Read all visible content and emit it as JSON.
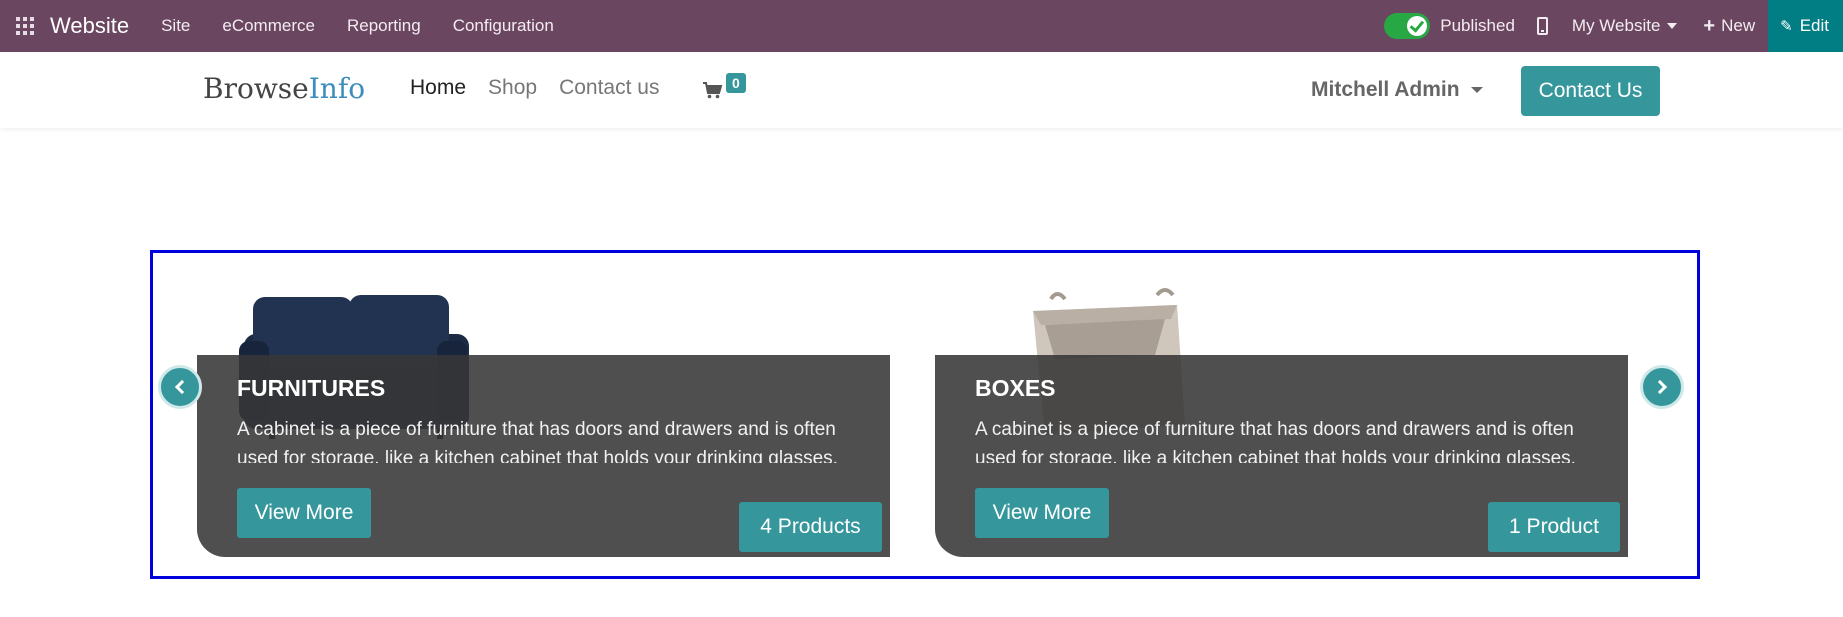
{
  "topbar": {
    "app_name": "Website",
    "menu": [
      "Site",
      "eCommerce",
      "Reporting",
      "Configuration"
    ],
    "published_label": "Published",
    "website_selector": "My Website",
    "new_label": "New",
    "edit_label": "Edit",
    "colors": {
      "background": "#6b4660",
      "edit_background": "#017e84",
      "toggle_on": "#28a745"
    }
  },
  "header": {
    "logo_part1": "Browse",
    "logo_part2": "Info",
    "nav": [
      "Home",
      "Shop",
      "Contact us"
    ],
    "active_nav": "Home",
    "cart_count": "0",
    "user_name": "Mitchell Admin",
    "contact_button": "Contact Us",
    "accent_color": "#35979c"
  },
  "carousel": {
    "cards": [
      {
        "title": "FURNITURES",
        "description": "A cabinet is a piece of furniture that has doors and drawers and is often used for storage, like a kitchen cabinet that holds your drinking glasses.",
        "view_button": "View More",
        "count_label": "4 Products",
        "image": "sofa"
      },
      {
        "title": "BOXES",
        "description": "A cabinet is a piece of furniture that has doors and drawers and is often used for storage, like a kitchen cabinet that holds your drinking glasses.",
        "view_button": "View More",
        "count_label": "1 Product",
        "image": "storage-basket"
      }
    ],
    "prev_icon": "chevron-left-icon",
    "next_icon": "chevron-right-icon",
    "selection_border_color": "#0000dd"
  }
}
